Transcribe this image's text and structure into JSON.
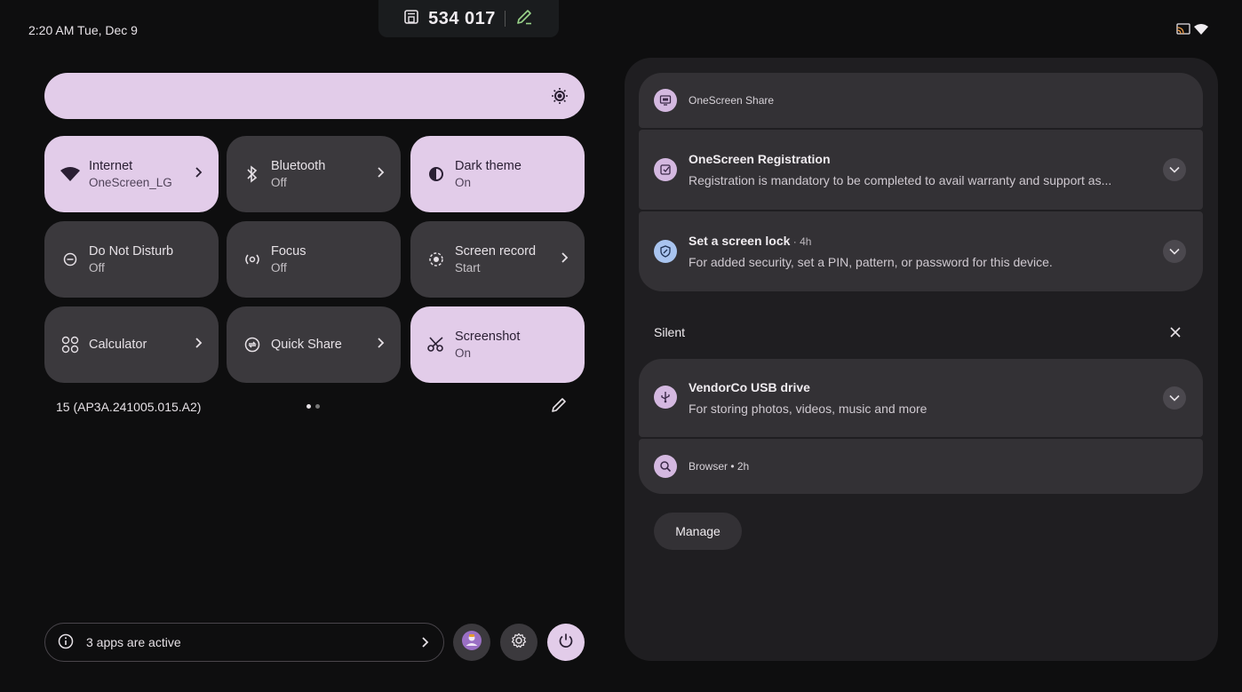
{
  "status_bar": {
    "time_date": "2:20 AM  Tue, Dec 9",
    "meeting_code": "534 017"
  },
  "tiles": [
    {
      "label": "Internet",
      "sub": "OneScreen_LG",
      "icon": "wifi-icon",
      "on": true,
      "chevron": true
    },
    {
      "label": "Bluetooth",
      "sub": "Off",
      "icon": "bluetooth-icon",
      "on": false,
      "chevron": true
    },
    {
      "label": "Dark theme",
      "sub": "On",
      "icon": "contrast-icon",
      "on": true,
      "chevron": false
    },
    {
      "label": "Do Not Disturb",
      "sub": "Off",
      "icon": "do-not-disturb-icon",
      "on": false,
      "chevron": false
    },
    {
      "label": "Focus",
      "sub": "Off",
      "icon": "focus-icon",
      "on": false,
      "chevron": false
    },
    {
      "label": "Screen record",
      "sub": "Start",
      "icon": "screen-record-icon",
      "on": false,
      "chevron": true
    },
    {
      "label": "Calculator",
      "sub": "",
      "icon": "calculator-icon",
      "on": false,
      "chevron": true
    },
    {
      "label": "Quick Share",
      "sub": "",
      "icon": "quick-share-icon",
      "on": false,
      "chevron": true
    },
    {
      "label": "Screenshot",
      "sub": "On",
      "icon": "scissors-icon",
      "on": true,
      "chevron": false
    }
  ],
  "build_number": "15 (AP3A.241005.015.A2)",
  "bottom": {
    "active_apps": "3 apps are active"
  },
  "notifications": {
    "share": {
      "app": "OneScreen Share"
    },
    "registration": {
      "title": "OneScreen Registration",
      "body": "Registration is mandatory to be completed to avail warranty and support as..."
    },
    "screen_lock": {
      "title": "Set a screen lock",
      "meta": " · 4h",
      "body": "For added security, set a PIN, pattern, or password for this device."
    },
    "silent_header": "Silent",
    "usb": {
      "title": "VendorCo USB drive",
      "body": "For storing photos, videos, music and more"
    },
    "browser": {
      "label": "Browser • 2h"
    },
    "manage_label": "Manage"
  },
  "colors": {
    "accent": "#e2cce9",
    "tile_off": "#3b393d",
    "panel": "#1f1e21",
    "card": "#333135"
  }
}
